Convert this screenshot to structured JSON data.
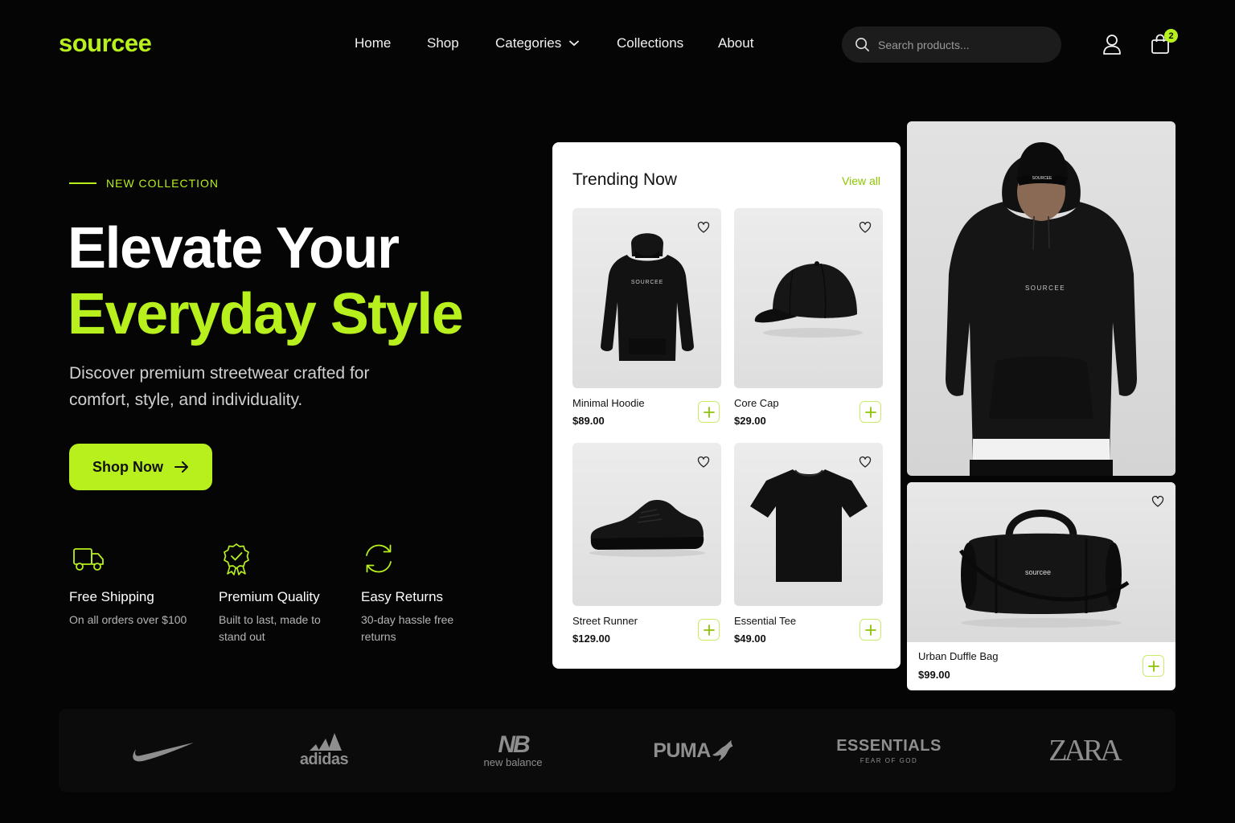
{
  "brand": {
    "logo": "sourcee"
  },
  "nav": {
    "items": [
      {
        "label": "Home"
      },
      {
        "label": "Shop"
      },
      {
        "label": "Categories"
      },
      {
        "label": "Collections"
      },
      {
        "label": "About"
      }
    ]
  },
  "search": {
    "placeholder": "Search products..."
  },
  "cart": {
    "count": "2"
  },
  "hero": {
    "eyebrow": "NEW COLLECTION",
    "title_line1": "Elevate Your",
    "title_line2": "Everyday Style",
    "subtitle": "Discover premium streetwear crafted for comfort, style, and individuality.",
    "cta": "Shop Now"
  },
  "features": [
    {
      "icon": "truck-icon",
      "title": "Free Shipping",
      "desc": "On all orders over $100"
    },
    {
      "icon": "badge-check-icon",
      "title": "Premium Quality",
      "desc": "Built to last, made to stand out"
    },
    {
      "icon": "refresh-icon",
      "title": "Easy Returns",
      "desc": "30-day hassle free returns"
    }
  ],
  "trending": {
    "title": "Trending Now",
    "view_all": "View all",
    "products": [
      {
        "name": "Minimal Hoodie",
        "price": "$89.00",
        "print": "SOURCEE"
      },
      {
        "name": "Core Cap",
        "price": "$29.00"
      },
      {
        "name": "Street Runner",
        "price": "$129.00"
      },
      {
        "name": "Essential Tee",
        "price": "$49.00"
      }
    ]
  },
  "featured": {
    "model_print": "SOURCEE",
    "cap_print": "SOURCEE",
    "bag": {
      "name": "Urban Duffle Bag",
      "price": "$99.00",
      "print": "sourcee"
    }
  },
  "brands": [
    {
      "name": "nike"
    },
    {
      "name": "adidas"
    },
    {
      "name": "new balance"
    },
    {
      "name": "PUMA"
    },
    {
      "name": "ESSENTIALS",
      "sub": "FEAR OF GOD"
    },
    {
      "name": "ZARA"
    }
  ],
  "colors": {
    "accent": "#b8f01e",
    "background": "#050505",
    "card": "#ffffff"
  }
}
